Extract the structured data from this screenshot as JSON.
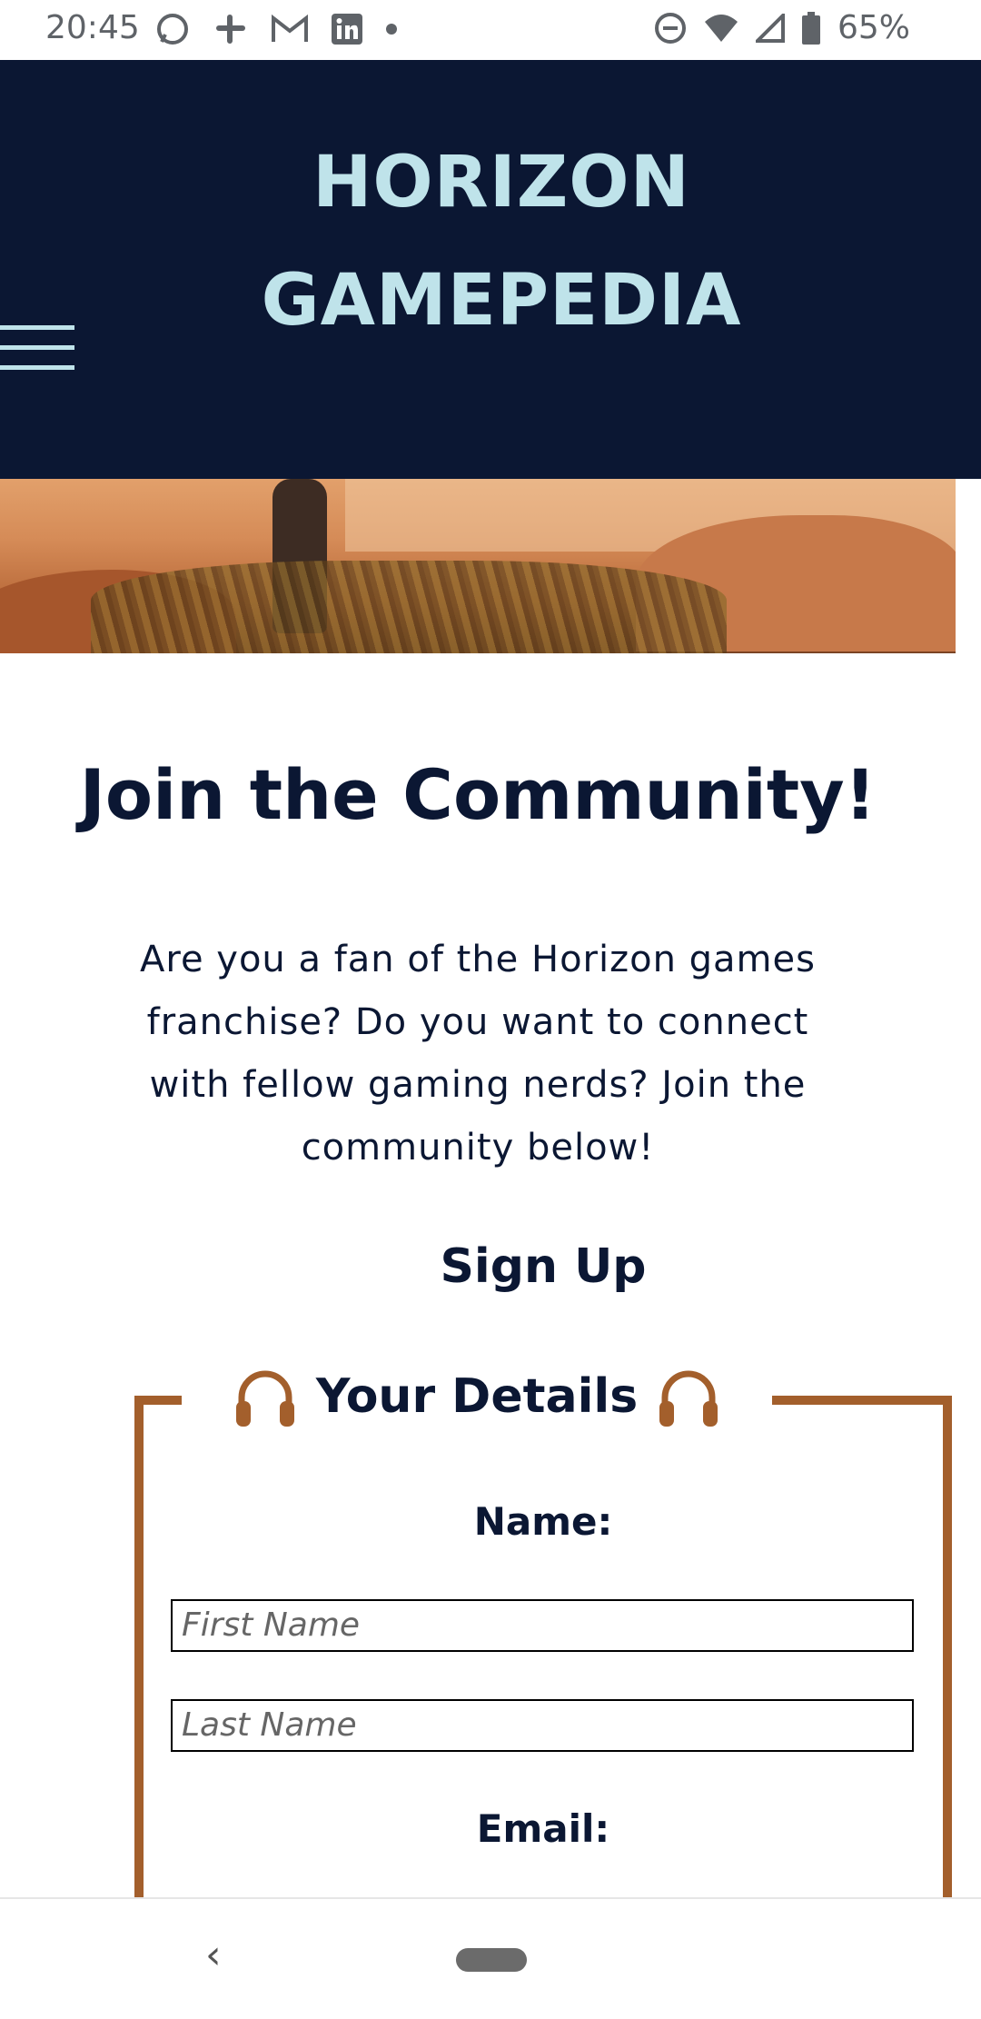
{
  "status_bar": {
    "time": "20:45",
    "left_icons": [
      "whatsapp-icon",
      "slack-icon",
      "gmail-icon",
      "linkedin-icon",
      "dot-icon"
    ],
    "right_icons": [
      "dnd-icon",
      "wifi-icon",
      "signal-icon",
      "battery-icon"
    ],
    "battery": "65%"
  },
  "header": {
    "title_line1": "HORIZON",
    "title_line2": "GAMEPEDIA",
    "bg_color": "#0b1733",
    "title_color": "#bfe3ea"
  },
  "main": {
    "heading": "Join the Community!",
    "intro": "Are you a fan of the Horizon games franchise? Do you want to connect with fellow gaming nerds? Join the community below!",
    "signup_heading": "Sign Up"
  },
  "form": {
    "legend": "Your Details",
    "legend_icon": "headphones-icon",
    "border_color": "#a35f2c",
    "name_label": "Name:",
    "first_name_placeholder": "First Name",
    "last_name_placeholder": "Last Name",
    "email_label": "Email:"
  },
  "nav_bar": {
    "back_icon": "back-chevron-icon",
    "home_icon": "home-pill-icon"
  }
}
